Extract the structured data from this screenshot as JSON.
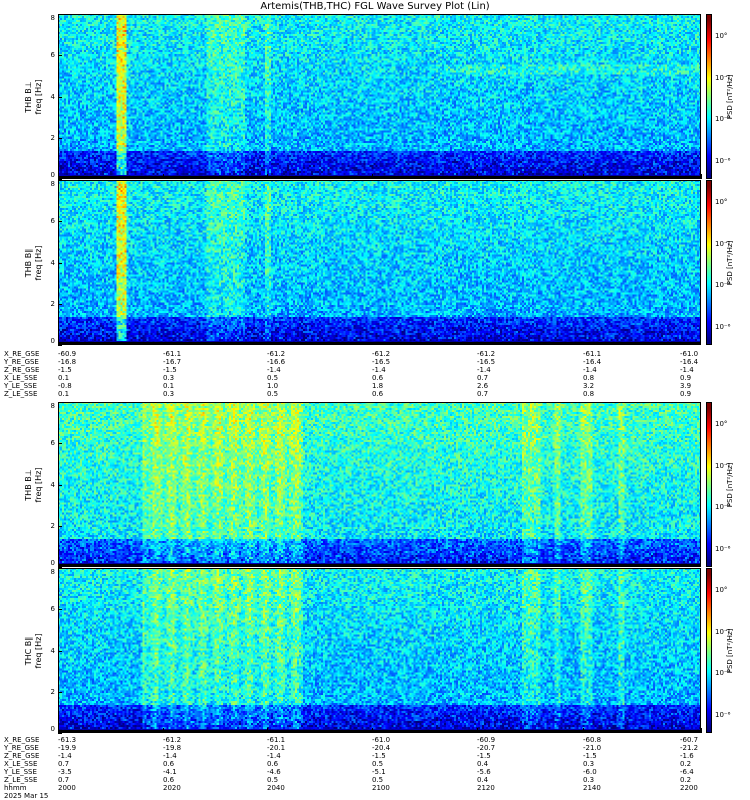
{
  "title": "Artemis(THB,THC) FGL Wave Survey Plot (Lin)",
  "chart_data": [
    {
      "type": "heatmap",
      "panel_label": [
        "THB B⊥",
        "freq [Hz]"
      ],
      "probe": "THB",
      "component": "perp",
      "freq_ticks": [
        "0",
        "2",
        "4",
        "6",
        "8"
      ],
      "ylim": [
        0,
        8
      ],
      "colorbar_label": "PSD [nT²/Hz]",
      "colorbar_ticks": [
        "10°",
        "10⁻²",
        "10⁻⁴",
        "10⁻⁶"
      ],
      "log_color_scale": true
    },
    {
      "type": "heatmap",
      "panel_label": [
        "THB B∥",
        "freq [Hz]"
      ],
      "probe": "THB",
      "component": "par",
      "freq_ticks": [
        "0",
        "2",
        "4",
        "6",
        "8"
      ],
      "ylim": [
        0,
        8
      ],
      "colorbar_label": "PSD [nT²/Hz]",
      "colorbar_ticks": [
        "10°",
        "10⁻²",
        "10⁻⁴",
        "10⁻⁶"
      ],
      "log_color_scale": true
    },
    {
      "type": "heatmap",
      "panel_label": [
        "THB B⊥",
        "freq [Hz]"
      ],
      "probe": "THC",
      "component": "perp",
      "freq_ticks": [
        "0",
        "2",
        "4",
        "6",
        "8"
      ],
      "ylim": [
        0,
        8
      ],
      "colorbar_label": "PSD [nT²/Hz]",
      "colorbar_ticks": [
        "10°",
        "10⁻²",
        "10⁻⁴",
        "10⁻⁶"
      ],
      "log_color_scale": true
    },
    {
      "type": "heatmap",
      "panel_label": [
        "THC B∥",
        "freq [Hz]"
      ],
      "probe": "THC",
      "component": "par",
      "freq_ticks": [
        "0",
        "2",
        "4",
        "6",
        "8"
      ],
      "ylim": [
        0,
        8
      ],
      "colorbar_label": "PSD [nT²/Hz]",
      "colorbar_ticks": [
        "10°",
        "10⁻²",
        "10⁻⁴",
        "10⁻⁶"
      ],
      "log_color_scale": true
    }
  ],
  "ephem_top": {
    "rows": [
      {
        "label": "X_RE_GSE",
        "values": [
          "-60.9",
          "-61.1",
          "-61.2",
          "-61.2",
          "-61.2",
          "-61.1",
          "-61.0"
        ]
      },
      {
        "label": "Y_RE_GSE",
        "values": [
          "-16.8",
          "-16.7",
          "-16.6",
          "-16.5",
          "-16.5",
          "-16.4",
          "-16.4"
        ]
      },
      {
        "label": "Z_RE_GSE",
        "values": [
          "-1.5",
          "-1.5",
          "-1.4",
          "-1.4",
          "-1.4",
          "-1.4",
          "-1.4"
        ]
      },
      {
        "label": "X_LE_SSE",
        "values": [
          "0.1",
          "0.3",
          "0.5",
          "0.6",
          "0.7",
          "0.8",
          "0.9"
        ]
      },
      {
        "label": "Y_LE_SSE",
        "values": [
          "-0.8",
          "0.1",
          "1.0",
          "1.8",
          "2.6",
          "3.2",
          "3.9"
        ]
      },
      {
        "label": "Z_LE_SSE",
        "values": [
          "0.1",
          "0.3",
          "0.5",
          "0.6",
          "0.7",
          "0.8",
          "0.9"
        ]
      }
    ]
  },
  "ephem_bottom": {
    "rows": [
      {
        "label": "X_RE_GSE",
        "values": [
          "-61.3",
          "-61.2",
          "-61.1",
          "-61.0",
          "-60.9",
          "-60.8",
          "-60.7"
        ]
      },
      {
        "label": "Y_RE_GSE",
        "values": [
          "-19.9",
          "-19.8",
          "-20.1",
          "-20.4",
          "-20.7",
          "-21.0",
          "-21.2"
        ]
      },
      {
        "label": "Z_RE_GSE",
        "values": [
          "-1.4",
          "-1.4",
          "-1.4",
          "-1.5",
          "-1.5",
          "-1.5",
          "-1.6"
        ]
      },
      {
        "label": "X_LE_SSE",
        "values": [
          "0.7",
          "0.6",
          "0.6",
          "0.5",
          "0.4",
          "0.3",
          "0.2"
        ]
      },
      {
        "label": "Y_LE_SSE",
        "values": [
          "-3.5",
          "-4.1",
          "-4.6",
          "-5.1",
          "-5.6",
          "-6.0",
          "-6.4"
        ]
      },
      {
        "label": "Z_LE_SSE",
        "values": [
          "0.7",
          "0.6",
          "0.5",
          "0.5",
          "0.4",
          "0.3",
          "0.2"
        ]
      },
      {
        "label": "hhmm",
        "values": [
          "2000",
          "2020",
          "2040",
          "2100",
          "2120",
          "2140",
          "2200"
        ]
      },
      {
        "label": "2025 Mar 15",
        "values": []
      }
    ]
  }
}
